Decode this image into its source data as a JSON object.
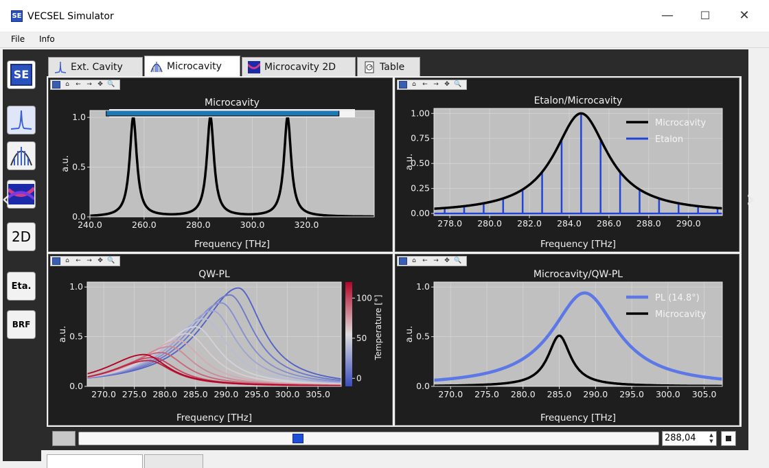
{
  "window": {
    "title": "VECSEL Simulator",
    "icon_text": "SE",
    "minimize": "—",
    "maximize": "☐",
    "close": "✕"
  },
  "menu": {
    "file": "File",
    "info": "Info"
  },
  "sidebar": {
    "items": [
      {
        "label": "SE",
        "icon": "se-logo-icon"
      },
      {
        "label": "",
        "icon": "single-peak-icon"
      },
      {
        "label": "",
        "icon": "multi-peak-icon"
      },
      {
        "label": "",
        "icon": "heatmap-icon"
      },
      {
        "label": "2D",
        "icon": "2d-icon"
      },
      {
        "label": "Eta.",
        "icon": "etalon-icon"
      },
      {
        "label": "BRF",
        "icon": "brf-icon"
      }
    ]
  },
  "tabs": [
    {
      "label": "Ext. Cavity",
      "icon": "single-peak-icon"
    },
    {
      "label": "Microcavity",
      "icon": "multi-peak-icon",
      "active": true
    },
    {
      "label": "Microcavity 2D",
      "icon": "heatmap-icon"
    },
    {
      "label": "Table",
      "icon": "table-icon"
    }
  ],
  "plot_toolbar": {
    "home": "⌂",
    "back": "←",
    "forward": "→",
    "pan": "✥",
    "zoom": "🔍"
  },
  "colors": {
    "panel_bg": "#1e1e1e",
    "plot_bg": "#c0c0c0",
    "microcavity": "#000000",
    "etalon": "#2143d6",
    "pl": "#5b78e6",
    "range_bar": "#1f77b4"
  },
  "chart_data": [
    {
      "type": "line",
      "title": "Microcavity",
      "xlabel": "Frequency [THz]",
      "ylabel": "a.u.",
      "xlim": [
        240,
        345
      ],
      "ylim": [
        0,
        1.07
      ],
      "xticks": [
        240.0,
        260.0,
        280.0,
        300.0,
        320.0
      ],
      "xtick_labels": [
        "240.0",
        "260.0",
        "280.0",
        "300.0",
        "320.0"
      ],
      "yticks": [
        0.0,
        0.5,
        1.0
      ],
      "ytick_labels": [
        "0.0",
        "0.5",
        "1.0"
      ],
      "grid": true,
      "range_bar": [
        246,
        332
      ],
      "series": [
        {
          "peaks": [
            256,
            284.5,
            313
          ],
          "hwhm": 1.6
        }
      ]
    },
    {
      "type": "line",
      "title": "Etalon/Microcavity",
      "xlabel": "Frequency [THz]",
      "ylabel": "a.u.",
      "xlim": [
        277.2,
        291.7
      ],
      "ylim": [
        -0.02,
        1.05
      ],
      "xticks": [
        278.0,
        280.0,
        282.0,
        284.0,
        286.0,
        288.0,
        290.0
      ],
      "xtick_labels": [
        "278.0",
        "280.0",
        "282.0",
        "284.0",
        "286.0",
        "288.0",
        "290.0"
      ],
      "yticks": [
        0.0,
        0.25,
        0.5,
        0.75,
        1.0
      ],
      "ytick_labels": [
        "0.00",
        "0.25",
        "0.50",
        "0.75",
        "1.00"
      ],
      "grid": true,
      "legend": "top-right",
      "series": [
        {
          "name": "Microcavity",
          "center": 284.6,
          "hwhm": 1.65
        },
        {
          "name": "Etalon",
          "spacing": 0.98,
          "origin": 284.6
        }
      ]
    },
    {
      "type": "line",
      "title": "QW-PL",
      "xlabel": "Frequency [THz]",
      "ylabel": "a.u.",
      "xlim": [
        267.3,
        308.8
      ],
      "ylim": [
        0,
        1.05
      ],
      "xticks": [
        270.0,
        275.0,
        280.0,
        285.0,
        290.0,
        295.0,
        300.0,
        305.0
      ],
      "xtick_labels": [
        "270.0",
        "275.0",
        "280.0",
        "285.0",
        "290.0",
        "295.0",
        "300.0",
        "305.0"
      ],
      "yticks": [
        0.0,
        0.5,
        1.0
      ],
      "ytick_labels": [
        "0.0",
        "0.5",
        "1.0"
      ],
      "grid": true,
      "colorbar": {
        "label": "Temperature [°]",
        "ticks": [
          0,
          50,
          100
        ],
        "tick_labels": [
          "0",
          "50",
          "100"
        ],
        "range": [
          -10,
          120
        ]
      },
      "series": [
        {
          "temps": [
            0,
            10,
            20,
            30,
            40,
            50,
            60,
            70,
            80,
            90,
            100,
            110,
            120
          ],
          "peak_x": [
            292,
            290.6,
            289.2,
            287.8,
            286.4,
            285,
            283.6,
            282.2,
            280.8,
            279.4,
            278,
            277.3,
            276.6
          ],
          "peak_y": [
            0.99,
            0.92,
            0.84,
            0.76,
            0.68,
            0.6,
            0.53,
            0.46,
            0.4,
            0.34,
            0.29,
            0.26,
            0.32
          ]
        }
      ]
    },
    {
      "type": "line",
      "title": "Microcavity/QW-PL",
      "xlabel": "Frequency [THz]",
      "ylabel": "a.u.",
      "xlim": [
        267.7,
        307.5
      ],
      "ylim": [
        0,
        1.05
      ],
      "xticks": [
        270.0,
        275.0,
        280.0,
        285.0,
        290.0,
        295.0,
        300.0,
        305.0
      ],
      "xtick_labels": [
        "270.0",
        "275.0",
        "280.0",
        "285.0",
        "290.0",
        "295.0",
        "300.0",
        "305.0"
      ],
      "yticks": [
        0.0,
        0.5,
        1.0
      ],
      "ytick_labels": [
        "0.0",
        "0.5",
        "1.0"
      ],
      "grid": true,
      "legend": "top-right",
      "series": [
        {
          "name": "PL (14.8°)",
          "center": 288.5,
          "hwhm": 5.5,
          "peak": 0.94
        },
        {
          "name": "Microcavity",
          "center": 285.0,
          "hwhm": 1.9,
          "peak": 0.51
        }
      ]
    }
  ],
  "slider": {
    "value_text": "288,04",
    "fraction": 0.376
  }
}
